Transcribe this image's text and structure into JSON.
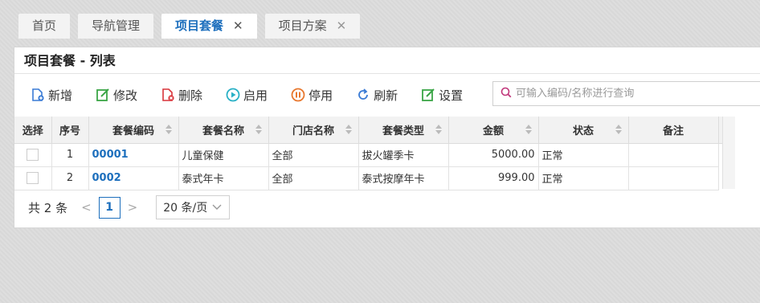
{
  "tabs": [
    {
      "label": "首页",
      "closable": false,
      "active": false
    },
    {
      "label": "导航管理",
      "closable": false,
      "active": false
    },
    {
      "label": "项目套餐",
      "closable": true,
      "active": true
    },
    {
      "label": "项目方案",
      "closable": true,
      "active": false
    }
  ],
  "close_glyph": "✕",
  "panel": {
    "title": "项目套餐 - 列表"
  },
  "toolbar": {
    "add": "新增",
    "edit": "修改",
    "delete": "删除",
    "enable": "启用",
    "disable": "停用",
    "refresh": "刷新",
    "settings": "设置"
  },
  "search": {
    "placeholder": "可输入编码/名称进行查询",
    "value": ""
  },
  "table": {
    "columns": [
      "选择",
      "序号",
      "套餐编码",
      "套餐名称",
      "门店名称",
      "套餐类型",
      "金额",
      "状态",
      "备注"
    ],
    "rows": [
      {
        "index": "1",
        "code": "00001",
        "name": "儿童保健",
        "store": "全部",
        "type": "拔火罐季卡",
        "amount": "5000.00",
        "status": "正常",
        "remark": ""
      },
      {
        "index": "2",
        "code": "0002",
        "name": "泰式年卡",
        "store": "全部",
        "type": "泰式按摩年卡",
        "amount": "999.00",
        "status": "正常",
        "remark": ""
      }
    ]
  },
  "pager": {
    "total_text": "共 2 条",
    "prev": "<",
    "next": ">",
    "current": "1",
    "page_size": "20 条/页"
  },
  "colors": {
    "accent": "#1d6fbd",
    "add": "#3a7bd5",
    "edit": "#3aa546",
    "delete": "#d9343a",
    "enable": "#2ab1c6",
    "disable": "#e8782f",
    "refresh": "#3a7bd5",
    "settings": "#3aa546",
    "search": "#c0367a"
  }
}
